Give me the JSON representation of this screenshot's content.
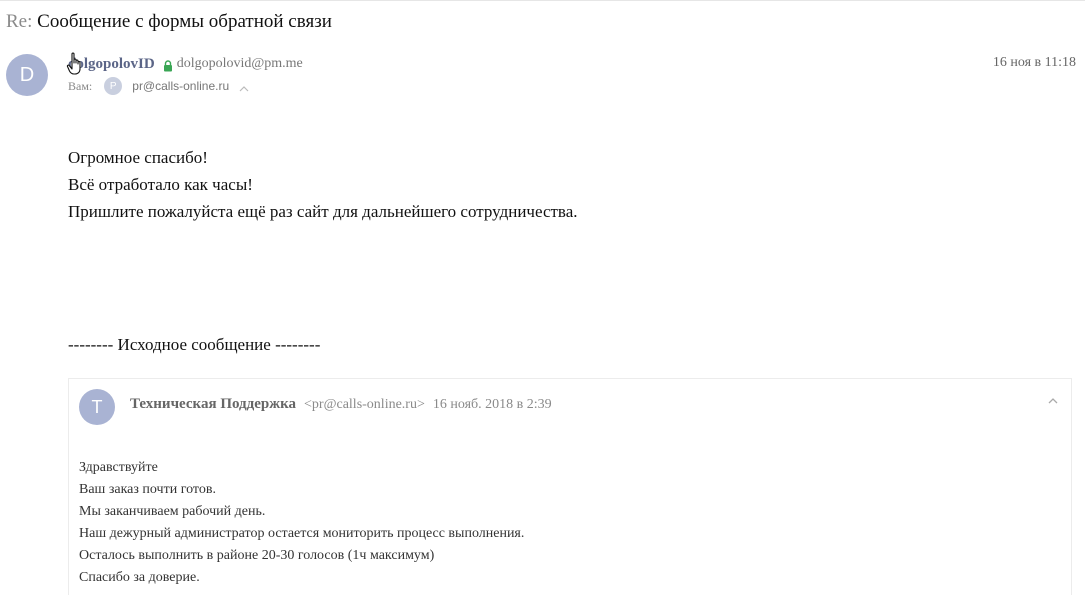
{
  "message": {
    "subject_prefix": "Re:",
    "subject": "Сообщение с формы обратной связи",
    "sender": {
      "initial": "D",
      "name": "dolgopolovID",
      "email": "dolgopolovid@pm.me",
      "verified_icon": "lock-icon"
    },
    "date": "16 ноя в 11:18",
    "recipients": {
      "label": "Вам:",
      "initial": "P",
      "email": "pr@calls-online.ru"
    },
    "body_lines": [
      "Огромное спасибо!",
      "Всё отработало как часы!",
      "Пришлите пожалуйста ещё раз сайт для дальнейшего сотрудничества."
    ],
    "original_separator": "-------- Исходное сообщение --------"
  },
  "quoted": {
    "initial": "T",
    "sender_name": "Техническая Поддержка",
    "sender_email": "<pr@calls-online.ru>",
    "date": "16 нояб. 2018 в 2:39",
    "body_lines": [
      "Здравствуйте",
      "Ваш заказ почти готов.",
      "Мы заканчиваем рабочий день.",
      "Наш дежурный администратор остается мониторить процесс выполнения.",
      "Осталось выполнить в районе 20-30 голосов (1ч максимум)",
      "Спасибо за доверие."
    ]
  },
  "colors": {
    "avatar": "#a9b3d3",
    "sender_name": "#5b6587",
    "lock": "#3aa655"
  }
}
